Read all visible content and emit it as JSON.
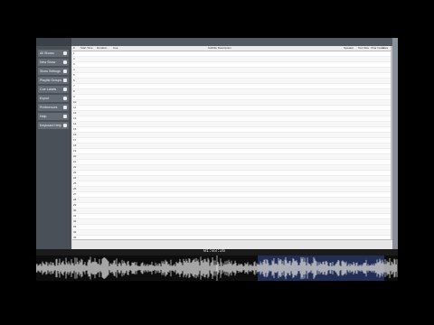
{
  "sidebar": {
    "header": "",
    "buttons": [
      {
        "label": "All Shows",
        "icon": "list-icon"
      },
      {
        "label": "New Show",
        "icon": "plus-icon"
      },
      {
        "label": "Show Settings",
        "icon": "gear-icon"
      },
      {
        "label": "Playlist Groups",
        "icon": "folder-icon"
      },
      {
        "label": "Cue Labels",
        "icon": "tag-icon"
      },
      {
        "label": "Export",
        "icon": "export-icon"
      },
      {
        "label": "Preferences",
        "icon": "gear-icon"
      },
      {
        "label": "Help",
        "icon": "help-icon"
      },
      {
        "label": "Keyboard Help",
        "icon": "keyboard-icon"
      }
    ]
  },
  "topbar": {
    "left": "",
    "center": "",
    "right": ""
  },
  "grid": {
    "columns": [
      "#",
      "Start Time",
      "Duration",
      "Cue",
      "Subtitle Description",
      "Speaker",
      "Text Size",
      "Char Count",
      "Lines",
      "Rate"
    ],
    "rows": [
      {
        "n": "1",
        "start": "",
        "dur": "",
        "cps": "",
        "text": "",
        "r1": "",
        "r2": "",
        "r3": "",
        "r4": "",
        "hl": "yellow"
      },
      {
        "n": "2",
        "start": "",
        "dur": "",
        "cps": "",
        "text": "",
        "r1": "",
        "r2": "",
        "r3": "",
        "r4": "",
        "hl": "yellow"
      },
      {
        "n": "3",
        "start": "",
        "dur": "",
        "cps": "",
        "text": "",
        "r1": "",
        "r2": "",
        "r3": "",
        "r4": "",
        "hl": "yellow"
      },
      {
        "n": "4",
        "start": "",
        "dur": "",
        "cps": "",
        "text": "",
        "r1": "",
        "r2": "",
        "r3": "",
        "r4": "",
        "hl": "yellow"
      },
      {
        "n": "5",
        "start": "",
        "dur": "",
        "cps": "",
        "text": "",
        "r1": "",
        "r2": "",
        "r3": "",
        "r4": "",
        "hl": "yellow"
      },
      {
        "n": "6",
        "start": "",
        "dur": "",
        "cps": "",
        "text": "",
        "r1": "",
        "r2": "",
        "r3": "",
        "r4": "",
        "hl": "yellow"
      },
      {
        "n": "7",
        "start": "",
        "dur": "",
        "cps": "",
        "text": "",
        "r1": "",
        "r2": "",
        "r3": "",
        "r4": "",
        "hl": "yellow"
      },
      {
        "n": "8",
        "start": "",
        "dur": "",
        "cps": "",
        "text": "",
        "r1": "",
        "r2": "",
        "r3": "",
        "r4": "",
        "hl": "yellow"
      },
      {
        "n": "9",
        "start": "",
        "dur": "",
        "cps": "",
        "text": "",
        "r1": "",
        "r2": "",
        "r3": "",
        "r4": "",
        "hl": "yellow"
      },
      {
        "n": "10",
        "start": "",
        "dur": "",
        "cps": "",
        "text": "",
        "r1": "",
        "r2": "",
        "r3": "",
        "r4": "",
        "hl": "yellow"
      },
      {
        "n": "11",
        "start": "",
        "dur": "",
        "cps": "",
        "text": "",
        "r1": "",
        "r2": "",
        "r3": "",
        "r4": "",
        "hl": "yellow"
      },
      {
        "n": "12",
        "start": "",
        "dur": "",
        "cps": "",
        "text": "",
        "r1": "",
        "r2": "",
        "r3": "",
        "r4": "",
        "hl": "yellow"
      },
      {
        "n": "13",
        "start": "",
        "dur": "",
        "cps": "",
        "text": "",
        "r1": "",
        "r2": "",
        "r3": "",
        "r4": "",
        "hl": "yellow"
      },
      {
        "n": "14",
        "start": "",
        "dur": "",
        "cps": "",
        "text": "",
        "r1": "",
        "r2": "",
        "r3": "",
        "r4": "",
        "hl": "yellow"
      },
      {
        "n": "15",
        "start": "",
        "dur": "",
        "cps": "",
        "text": "",
        "r1": "",
        "r2": "",
        "r3": "",
        "r4": "",
        "hl": "red"
      },
      {
        "n": "16",
        "start": "",
        "dur": "",
        "cps": "",
        "text": "",
        "r1": "",
        "r2": "",
        "r3": "",
        "r4": "",
        "hl": ""
      },
      {
        "n": "17",
        "start": "",
        "dur": "",
        "cps": "",
        "text": "",
        "r1": "",
        "r2": "",
        "r3": "",
        "r4": "",
        "hl": ""
      },
      {
        "n": "18",
        "start": "",
        "dur": "",
        "cps": "",
        "text": "",
        "r1": "",
        "r2": "",
        "r3": "",
        "r4": "",
        "hl": ""
      },
      {
        "n": "19",
        "start": "",
        "dur": "",
        "cps": "",
        "text": "",
        "r1": "",
        "r2": "",
        "r3": "",
        "r4": "",
        "hl": ""
      },
      {
        "n": "20",
        "start": "",
        "dur": "",
        "cps": "",
        "text": "",
        "r1": "",
        "r2": "",
        "r3": "",
        "r4": "",
        "hl": ""
      },
      {
        "n": "21",
        "start": "",
        "dur": "",
        "cps": "",
        "text": "",
        "r1": "",
        "r2": "",
        "r3": "",
        "r4": "",
        "hl": ""
      },
      {
        "n": "22",
        "start": "",
        "dur": "",
        "cps": "",
        "text": "",
        "r1": "",
        "r2": "",
        "r3": "",
        "r4": "",
        "hl": ""
      },
      {
        "n": "23",
        "start": "",
        "dur": "",
        "cps": "",
        "text": "",
        "r1": "",
        "r2": "",
        "r3": "",
        "r4": "",
        "hl": ""
      },
      {
        "n": "24",
        "start": "",
        "dur": "",
        "cps": "",
        "text": "",
        "r1": "",
        "r2": "",
        "r3": "",
        "r4": "",
        "hl": ""
      },
      {
        "n": "25",
        "start": "",
        "dur": "",
        "cps": "",
        "text": "",
        "r1": "",
        "r2": "",
        "r3": "",
        "r4": "",
        "hl": ""
      },
      {
        "n": "26",
        "start": "",
        "dur": "",
        "cps": "",
        "text": "",
        "r1": "",
        "r2": "",
        "r3": "",
        "r4": "",
        "hl": ""
      },
      {
        "n": "27",
        "start": "",
        "dur": "",
        "cps": "",
        "text": "",
        "r1": "",
        "r2": "",
        "r3": "",
        "r4": "",
        "hl": ""
      },
      {
        "n": "28",
        "start": "",
        "dur": "",
        "cps": "",
        "text": "",
        "r1": "",
        "r2": "",
        "r3": "",
        "r4": "",
        "hl": ""
      },
      {
        "n": "29",
        "start": "",
        "dur": "",
        "cps": "",
        "text": "",
        "r1": "",
        "r2": "",
        "r3": "",
        "r4": "",
        "hl": ""
      },
      {
        "n": "30",
        "start": "",
        "dur": "",
        "cps": "",
        "text": "",
        "r1": "",
        "r2": "",
        "r3": "",
        "r4": "",
        "hl": ""
      },
      {
        "n": "31",
        "start": "",
        "dur": "",
        "cps": "",
        "text": "",
        "r1": "",
        "r2": "",
        "r3": "",
        "r4": "",
        "hl": ""
      },
      {
        "n": "32",
        "start": "",
        "dur": "",
        "cps": "",
        "text": "",
        "r1": "",
        "r2": "",
        "r3": "",
        "r4": "",
        "hl": ""
      },
      {
        "n": "33",
        "start": "",
        "dur": "",
        "cps": "",
        "text": "",
        "r1": "",
        "r2": "",
        "r3": "",
        "r4": "",
        "hl": ""
      },
      {
        "n": "34",
        "start": "",
        "dur": "",
        "cps": "",
        "text": "",
        "r1": "",
        "r2": "",
        "r3": "",
        "r4": "",
        "hl": ""
      },
      {
        "n": "35",
        "start": "",
        "dur": "",
        "cps": "",
        "text": "",
        "r1": "",
        "r2": "",
        "r3": "",
        "r4": "",
        "hl": ""
      }
    ]
  },
  "right_tab": "",
  "status": {
    "right": ""
  },
  "waveform": {
    "timecode": "01:03:26",
    "markers": [
      {
        "label": ""
      },
      {
        "label": ""
      },
      {
        "label": ""
      },
      {
        "label": ""
      }
    ],
    "colors": {
      "wave": "#cfcfcf",
      "selected": "#4a6ee0",
      "background": "#0d0d0d"
    }
  },
  "colors": {
    "highlight": "#f1e31c",
    "highlight_border": "#d04020",
    "sidebar": "#4a5058"
  }
}
